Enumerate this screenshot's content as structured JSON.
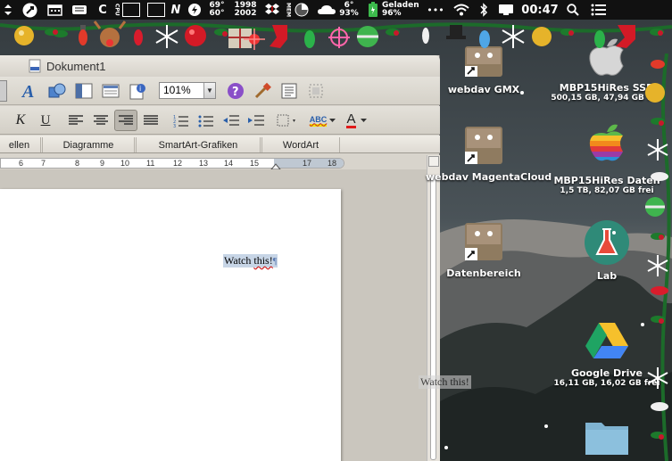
{
  "menubar": {
    "temps": {
      "line1": "69°",
      "line2": "60°"
    },
    "numbers": {
      "line1": "1998",
      "line2": "2002"
    },
    "weather": {
      "line1": "6°",
      "line2": "93%"
    },
    "battery": {
      "line1": "Geladen",
      "line2": "96%"
    },
    "cpu_label": "CPU",
    "mem_label": "MEM",
    "n_letter": "N",
    "c_letter": "C",
    "dots": "•••",
    "clock": "00:47"
  },
  "word": {
    "title": "Dokument1",
    "zoom": "101%",
    "ribbon_tabs": [
      "ellen",
      "Diagramme",
      "SmartArt-Grafiken",
      "WordArt"
    ],
    "ruler_numbers": [
      "6",
      "7",
      "8",
      "9",
      "10",
      "11",
      "12",
      "13",
      "14",
      "15",
      "17",
      "18"
    ],
    "font_button_k": "K",
    "font_button_u": "U",
    "font_color_letter": "A",
    "highlight_letters": "ABC",
    "doc_text_1": "Watch ",
    "doc_text_2": "this!",
    "pilcrow": "¶"
  },
  "desktop": {
    "icons": [
      {
        "label": "webdav GMX",
        "sub": ""
      },
      {
        "label": "MBP15HiRes SSD",
        "sub": "500,15 GB, 47,94 GB frei"
      },
      {
        "label": "webdav MagentaCloud",
        "sub": ""
      },
      {
        "label": "MBP15HiRes Daten",
        "sub": "1,5 TB, 82,07 GB frei"
      },
      {
        "label": "Datenbereich",
        "sub": ""
      },
      {
        "label": "Lab",
        "sub": ""
      },
      {
        "label": "Google Drive",
        "sub": "16,11 GB, 16,02 GB frei"
      }
    ],
    "drag_ghost": "Watch this!"
  }
}
